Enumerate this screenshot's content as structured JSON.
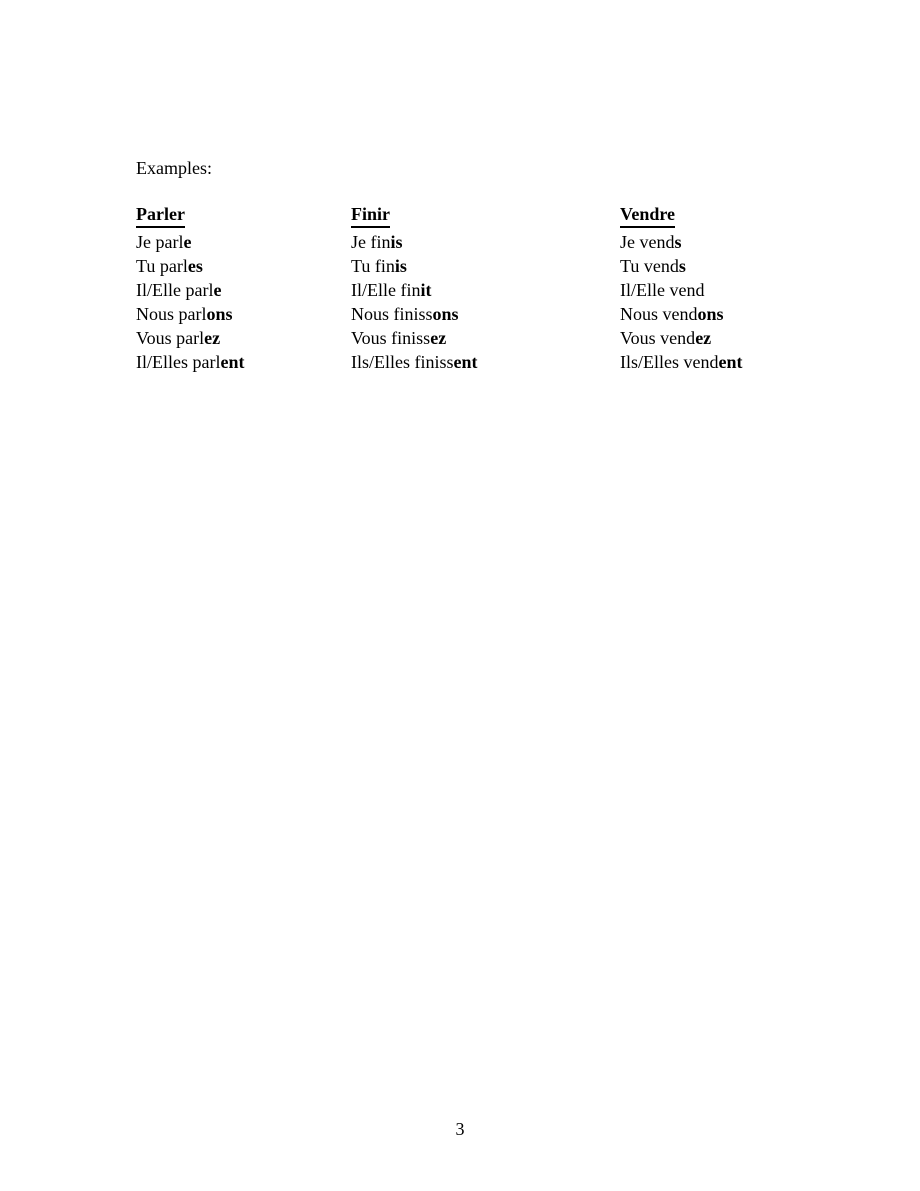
{
  "document": {
    "intro_label": "Examples:",
    "page_number": "3",
    "columns": [
      {
        "heading": "Parler",
        "rows": [
          {
            "stem": "Je parl",
            "ending": "e"
          },
          {
            "stem": "Tu parl",
            "ending": "es"
          },
          {
            "stem": "Il/Elle parl",
            "ending": "e"
          },
          {
            "stem": "Nous parl",
            "ending": "ons"
          },
          {
            "stem": "Vous parl",
            "ending": "ez"
          },
          {
            "stem": "Il/Elles parl",
            "ending": "ent"
          }
        ]
      },
      {
        "heading": "Finir",
        "rows": [
          {
            "stem": "Je fin",
            "ending": "is"
          },
          {
            "stem": "Tu fin",
            "ending": "is"
          },
          {
            "stem": "Il/Elle fin",
            "ending": "it"
          },
          {
            "stem": "Nous finiss",
            "ending": "ons"
          },
          {
            "stem": "Vous finiss",
            "ending": "ez"
          },
          {
            "stem": "Ils/Elles finiss",
            "ending": "ent"
          }
        ]
      },
      {
        "heading": "Vendre",
        "rows": [
          {
            "stem": "Je vend",
            "ending": "s"
          },
          {
            "stem": "Tu vend",
            "ending": "s"
          },
          {
            "stem": "Il/Elle vend",
            "ending": ""
          },
          {
            "stem": "Nous vend",
            "ending": "ons"
          },
          {
            "stem": "Vous vend",
            "ending": "ez"
          },
          {
            "stem": "Ils/Elles vend",
            "ending": "ent"
          }
        ]
      }
    ]
  }
}
